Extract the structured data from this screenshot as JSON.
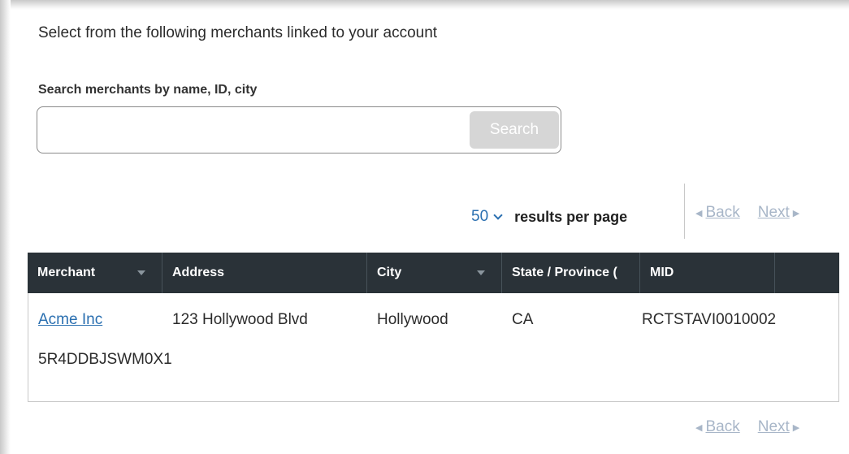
{
  "intro_text": "Select from the following merchants linked to your account",
  "search": {
    "label": "Search merchants by name, ID, city",
    "value": "",
    "placeholder": "",
    "button_label": "Search"
  },
  "pagination": {
    "per_page_value": "50",
    "per_page_label": "results per page",
    "back_label": "Back",
    "next_label": "Next"
  },
  "table": {
    "columns": [
      "Merchant",
      "Address",
      "City",
      "State / Province (",
      "MID"
    ],
    "rows": [
      {
        "merchant": "Acme Inc",
        "address": "123 Hollywood Blvd",
        "city": "Hollywood",
        "state": "CA",
        "mid": "RCTSTAVI0010002",
        "extra": "5R4DDBJSWM0X1"
      }
    ]
  },
  "colors": {
    "header_bg": "#2a3238",
    "link": "#2a6fb0",
    "disabled_button": "#d6d6d6",
    "disabled_nav": "#a8b6c8"
  },
  "icons": [
    "chevron-down-icon",
    "sort-arrow-icon",
    "triangle-left-icon",
    "triangle-right-icon"
  ]
}
